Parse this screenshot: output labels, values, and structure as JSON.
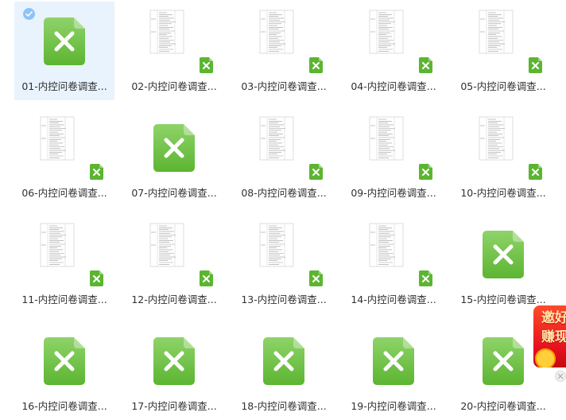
{
  "files": [
    {
      "label": "01-内控问卷调查...",
      "preview": "icon",
      "selected": true
    },
    {
      "label": "02-内控问卷调查...",
      "preview": "thumbnail",
      "selected": false
    },
    {
      "label": "03-内控问卷调查...",
      "preview": "thumbnail",
      "selected": false
    },
    {
      "label": "04-内控问卷调查...",
      "preview": "thumbnail",
      "selected": false
    },
    {
      "label": "05-内控问卷调查...",
      "preview": "thumbnail",
      "selected": false
    },
    {
      "label": "06-内控问卷调查...",
      "preview": "thumbnail",
      "selected": false
    },
    {
      "label": "07-内控问卷调查...",
      "preview": "icon",
      "selected": false
    },
    {
      "label": "08-内控问卷调查...",
      "preview": "thumbnail",
      "selected": false
    },
    {
      "label": "09-内控问卷调查...",
      "preview": "thumbnail",
      "selected": false
    },
    {
      "label": "10-内控问卷调查...",
      "preview": "thumbnail",
      "selected": false
    },
    {
      "label": "11-内控问卷调查...",
      "preview": "thumbnail",
      "selected": false
    },
    {
      "label": "12-内控问卷调查...",
      "preview": "thumbnail",
      "selected": false
    },
    {
      "label": "13-内控问卷调查...",
      "preview": "thumbnail",
      "selected": false
    },
    {
      "label": "14-内控问卷调查...",
      "preview": "thumbnail",
      "selected": false
    },
    {
      "label": "15-内控问卷调查...",
      "preview": "icon",
      "selected": false
    },
    {
      "label": "16-内控问卷调查...",
      "preview": "icon",
      "selected": false
    },
    {
      "label": "17-内控问卷调查...",
      "preview": "icon",
      "selected": false
    },
    {
      "label": "18-内控问卷调查...",
      "preview": "icon",
      "selected": false
    },
    {
      "label": "19-内控问卷调查...",
      "preview": "icon",
      "selected": false
    },
    {
      "label": "20-内控问卷调查...",
      "preview": "icon",
      "selected": false
    }
  ],
  "icons": {
    "file_type": "excel-file-icon",
    "selected_mark": "check-circle-icon",
    "close": "close-icon"
  },
  "promo": {
    "text_line1": "邀好",
    "text_line2": "赚现"
  },
  "colors": {
    "excel_green_light": "#8fd36a",
    "excel_green_dark": "#5cb531",
    "selected_bg": "#e9f3fd",
    "check_blue": "#8cc4f6",
    "label_text": "#303133",
    "promo_red": "#e5101e"
  }
}
